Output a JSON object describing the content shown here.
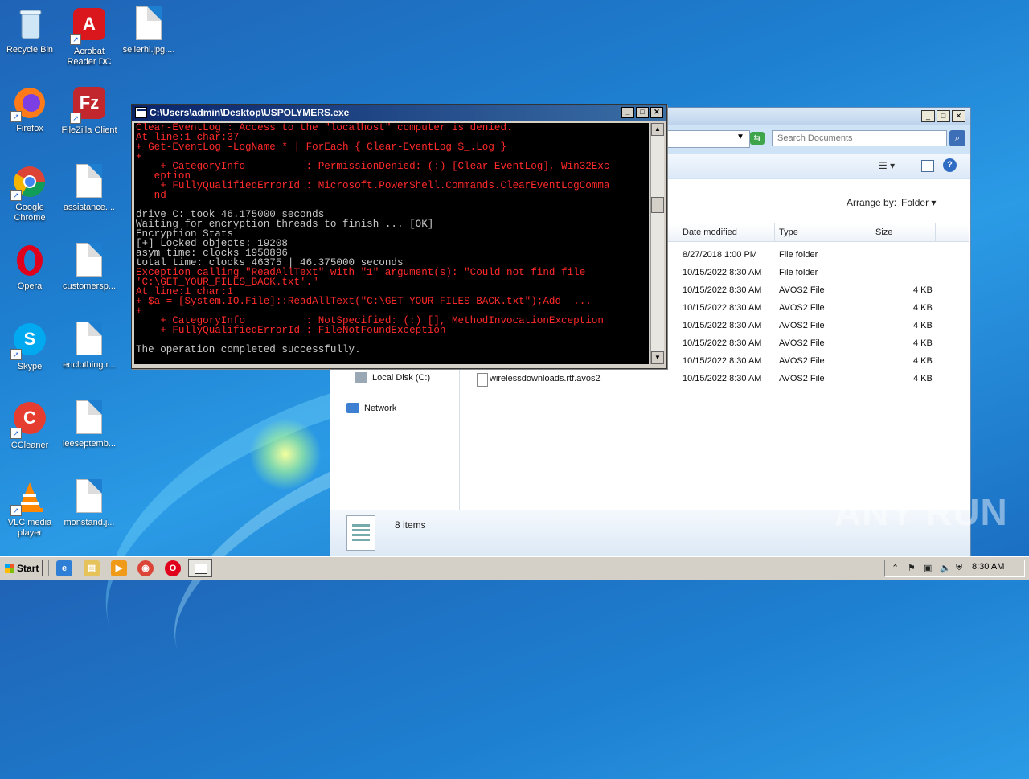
{
  "desktop": {
    "icons": [
      {
        "label": "Recycle Bin",
        "icon": "recycle-bin-icon"
      },
      {
        "label": "Acrobat Reader DC",
        "icon": "acrobat-icon"
      },
      {
        "label": "sellerhi.jpg....",
        "icon": "file-icon"
      },
      {
        "label": "Firefox",
        "icon": "firefox-icon"
      },
      {
        "label": "FileZilla Client",
        "icon": "filezilla-icon"
      },
      {
        "label": "Google Chrome",
        "icon": "chrome-icon"
      },
      {
        "label": "assistance....",
        "icon": "file-icon"
      },
      {
        "label": "Opera",
        "icon": "opera-icon"
      },
      {
        "label": "customersp...",
        "icon": "file-icon"
      },
      {
        "label": "Skype",
        "icon": "skype-icon"
      },
      {
        "label": "enclothing.r...",
        "icon": "file-icon"
      },
      {
        "label": "CCleaner",
        "icon": "ccleaner-icon"
      },
      {
        "label": "leeseptemb...",
        "icon": "file-icon"
      },
      {
        "label": "VLC media player",
        "icon": "vlc-icon"
      },
      {
        "label": "monstand.j...",
        "icon": "file-icon"
      }
    ]
  },
  "console": {
    "title": "C:\\Users\\admin\\Desktop\\USPOLYMERS.exe",
    "lines": [
      {
        "text": "Clear-EventLog : Access to the \"localhost\" computer is denied.",
        "color": "red"
      },
      {
        "text": "At line:1 char:37",
        "color": "red"
      },
      {
        "text": "+ Get-EventLog -LogName * | ForEach { Clear-EventLog $_.Log }",
        "color": "red"
      },
      {
        "text": "+",
        "color": "red"
      },
      {
        "text": "    + CategoryInfo          : PermissionDenied: (:) [Clear-EventLog], Win32Exc",
        "color": "red"
      },
      {
        "text": "   eption",
        "color": "red"
      },
      {
        "text": "    + FullyQualifiedErrorId : Microsoft.PowerShell.Commands.ClearEventLogComma",
        "color": "red"
      },
      {
        "text": "   nd",
        "color": "red"
      },
      {
        "text": "",
        "color": "gray"
      },
      {
        "text": "drive C: took 46.175000 seconds",
        "color": "gray"
      },
      {
        "text": "Waiting for encryption threads to finish ... [OK]",
        "color": "gray"
      },
      {
        "text": "Encryption Stats",
        "color": "gray"
      },
      {
        "text": "[+] Locked objects: 19208",
        "color": "gray"
      },
      {
        "text": "asym time: clocks 1950896",
        "color": "gray"
      },
      {
        "text": "total time: clocks 46375 | 46.375000 seconds",
        "color": "gray"
      },
      {
        "text": "Exception calling \"ReadAllText\" with \"1\" argument(s): \"Could not find file",
        "color": "red"
      },
      {
        "text": "'C:\\GET_YOUR_FILES_BACK.txt'.\"",
        "color": "red"
      },
      {
        "text": "At line:1 char:1",
        "color": "red"
      },
      {
        "text": "+ $a = [System.IO.File]::ReadAllText(\"C:\\GET_YOUR_FILES_BACK.txt\");Add- ...",
        "color": "red"
      },
      {
        "text": "+",
        "color": "red"
      },
      {
        "text": "    + CategoryInfo          : NotSpecified: (:) [], MethodInvocationException",
        "color": "red"
      },
      {
        "text": "    + FullyQualifiedErrorId : FileNotFoundException",
        "color": "red"
      },
      {
        "text": "",
        "color": "gray"
      },
      {
        "text": "The operation completed successfully.",
        "color": "gray"
      }
    ]
  },
  "explorer": {
    "search_placeholder": "Search Documents",
    "arrange_label": "Arrange by:",
    "arrange_value": "Folder",
    "columns": [
      "Date modified",
      "Type",
      "Size"
    ],
    "nav": [
      {
        "label": "Local Disk (C:)",
        "icon": "drive-icon"
      },
      {
        "label": "Network",
        "icon": "network-icon"
      }
    ],
    "rows": [
      {
        "name": "",
        "date": "8/27/2018 1:00 PM",
        "type": "File folder",
        "size": ""
      },
      {
        "name": "",
        "date": "10/15/2022 8:30 AM",
        "type": "File folder",
        "size": ""
      },
      {
        "name": "",
        "date": "10/15/2022 8:30 AM",
        "type": "AVOS2 File",
        "size": "4 KB"
      },
      {
        "name": "",
        "date": "10/15/2022 8:30 AM",
        "type": "AVOS2 File",
        "size": "4 KB"
      },
      {
        "name": "",
        "date": "10/15/2022 8:30 AM",
        "type": "AVOS2 File",
        "size": "4 KB"
      },
      {
        "name": "",
        "date": "10/15/2022 8:30 AM",
        "type": "AVOS2 File",
        "size": "4 KB"
      },
      {
        "name": "",
        "date": "10/15/2022 8:30 AM",
        "type": "AVOS2 File",
        "size": "4 KB"
      },
      {
        "name": "wirelessdownloads.rtf.avos2",
        "date": "10/15/2022 8:30 AM",
        "type": "AVOS2 File",
        "size": "4 KB"
      }
    ],
    "status": "8 items"
  },
  "taskbar": {
    "start_label": "Start",
    "clock": "8:30 AM"
  },
  "watermark": "ANY RUN"
}
